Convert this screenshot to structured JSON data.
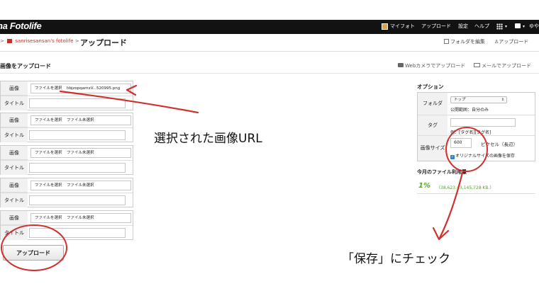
{
  "topbar": {
    "logo": "na Fotolife",
    "nav": [
      "マイフォト",
      "アップロード",
      "設定",
      "ヘルプ"
    ],
    "icons": [
      "myfoto-icon",
      "apps-grid-icon",
      "chat-icon",
      "user-menu-icon"
    ],
    "user_partial": "ゆや"
  },
  "breadcrumb": {
    "lead": ">",
    "owner": "sanrisesansan's fotolife",
    "sep": ">",
    "title": "アップロード"
  },
  "toplinks": {
    "edit_folder": "フォルダを編集",
    "upload": "アップロード"
  },
  "section": {
    "title": "画像をアップロード",
    "webcam": "Webカメラでアップロード",
    "mail": "メールでアップロード"
  },
  "form": {
    "image_label": "画像",
    "title_label": "タイトル",
    "choose_label": "ファイルを選択",
    "rows": [
      {
        "file": "hbjzopqamxV...520995.png"
      },
      {
        "file": "ファイル未選択"
      },
      {
        "file": "ファイル未選択"
      },
      {
        "file": "ファイル未選択"
      },
      {
        "file": "ファイル未選択"
      }
    ],
    "upload_button": "アップロード"
  },
  "options": {
    "title": "オプション",
    "folder_label": "フォルダ",
    "folder_value": "トップ",
    "public_range": "公開範囲：自分のみ",
    "tag_label": "タグ",
    "tag_example": "例：[タグ名][タグ名]",
    "size_label": "画像サイズ",
    "size_value": "600",
    "size_unit": "ピクセル（長辺）",
    "keep_original": "オリジナルサイズの画像を保存",
    "keep_original_checked": true
  },
  "usage": {
    "title": "今月のファイル利用量",
    "percent": "1%",
    "detail": "（38,623／3,145,728 KB.）"
  },
  "annotations": {
    "url_note": "選択された画像URL",
    "save_note": "「保存」にチェック",
    "color": "#d0312d"
  }
}
